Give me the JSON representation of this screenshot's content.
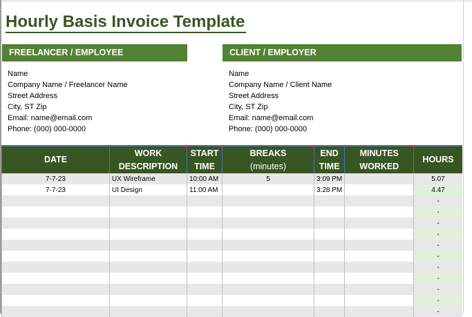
{
  "title": "Hourly Basis Invoice Template",
  "freelancer": {
    "heading": "FREELANCER / EMPLOYEE",
    "lines": [
      "Name",
      "Company Name / Freelancer Name",
      "Street Address",
      "City, ST Zip",
      "Email: name@email.com",
      "Phone: (000) 000-0000"
    ]
  },
  "client": {
    "heading": "CLIENT / EMPLOYER",
    "lines": [
      "Name",
      "Company Name / Client Name",
      "Street Address",
      "City, ST Zip",
      "Email: name@email.com",
      "Phone: (000) 000-0000"
    ]
  },
  "table": {
    "headers": [
      {
        "l1": "DATE",
        "l2": ""
      },
      {
        "l1": "WORK",
        "l2": "DESCRIPTION"
      },
      {
        "l1": "START",
        "l2": "TIME"
      },
      {
        "l1": "BREAKS",
        "l2": "(minutes)"
      },
      {
        "l1": "END",
        "l2": "TIME"
      },
      {
        "l1": "MINUTES",
        "l2": "WORKED"
      },
      {
        "l1": "HOURS",
        "l2": ""
      }
    ],
    "rows": [
      {
        "date": "7-7-23",
        "desc": "UX Wireframe",
        "start": "10:00 AM",
        "breaks": "5",
        "end": "3:09 PM",
        "minutes": "",
        "hours": "5.07"
      },
      {
        "date": "7-7-23",
        "desc": "UI Design",
        "start": "11:00 AM",
        "breaks": "",
        "end": "3:28 PM",
        "minutes": "",
        "hours": "4.47"
      },
      {
        "date": "",
        "desc": "",
        "start": "",
        "breaks": "",
        "end": "",
        "minutes": "",
        "hours": "-"
      },
      {
        "date": "",
        "desc": "",
        "start": "",
        "breaks": "",
        "end": "",
        "minutes": "",
        "hours": "-"
      },
      {
        "date": "",
        "desc": "",
        "start": "",
        "breaks": "",
        "end": "",
        "minutes": "",
        "hours": "-"
      },
      {
        "date": "",
        "desc": "",
        "start": "",
        "breaks": "",
        "end": "",
        "minutes": "",
        "hours": "-"
      },
      {
        "date": "",
        "desc": "",
        "start": "",
        "breaks": "",
        "end": "",
        "minutes": "",
        "hours": "-"
      },
      {
        "date": "",
        "desc": "",
        "start": "",
        "breaks": "",
        "end": "",
        "minutes": "",
        "hours": "-"
      },
      {
        "date": "",
        "desc": "",
        "start": "",
        "breaks": "",
        "end": "",
        "minutes": "",
        "hours": "-"
      },
      {
        "date": "",
        "desc": "",
        "start": "",
        "breaks": "",
        "end": "",
        "minutes": "",
        "hours": "-"
      },
      {
        "date": "",
        "desc": "",
        "start": "",
        "breaks": "",
        "end": "",
        "minutes": "",
        "hours": "-"
      },
      {
        "date": "",
        "desc": "",
        "start": "",
        "breaks": "",
        "end": "",
        "minutes": "",
        "hours": "-"
      },
      {
        "date": "",
        "desc": "",
        "start": "",
        "breaks": "",
        "end": "",
        "minutes": "",
        "hours": "-"
      }
    ]
  }
}
